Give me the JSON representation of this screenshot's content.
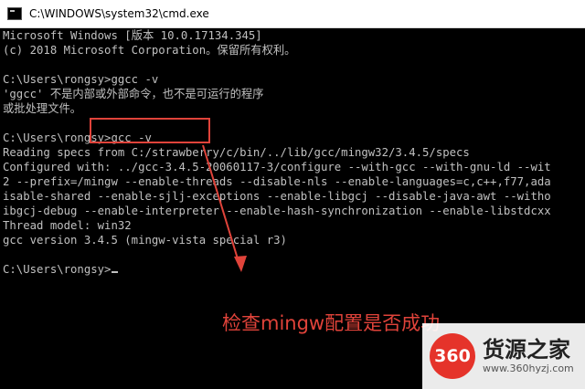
{
  "window": {
    "title": "C:\\WINDOWS\\system32\\cmd.exe",
    "icon": "cmd-console-icon"
  },
  "console": {
    "lines": [
      "Microsoft Windows [版本 10.0.17134.345]",
      "(c) 2018 Microsoft Corporation。保留所有权利。",
      "",
      "C:\\Users\\rongsy>ggcc -v",
      "'ggcc' 不是内部或外部命令，也不是可运行的程序",
      "或批处理文件。",
      "",
      "C:\\Users\\rongsy>gcc -v",
      "Reading specs from C:/strawberry/c/bin/../lib/gcc/mingw32/3.4.5/specs",
      "Configured with: ../gcc-3.4.5-20060117-3/configure --with-gcc --with-gnu-ld --wit",
      "2 --prefix=/mingw --enable-threads --disable-nls --enable-languages=c,c++,f77,ada",
      "isable-shared --enable-sjlj-exceptions --enable-libgcj --disable-java-awt --witho",
      "ibgcj-debug --enable-interpreter --enable-hash-synchronization --enable-libstdcxx",
      "Thread model: win32",
      "gcc version 3.4.5 (mingw-vista special r3)",
      "",
      "C:\\Users\\rongsy>"
    ]
  },
  "annotation": {
    "text": "检查mingw配置是否成功",
    "color": "#e0433a"
  },
  "watermark": {
    "badge": "360",
    "name": "货源之家",
    "url": "www.360hyzj.com"
  },
  "colors": {
    "console_bg": "#000000",
    "console_fg": "#c0c0c0",
    "accent_red": "#e0433a"
  }
}
